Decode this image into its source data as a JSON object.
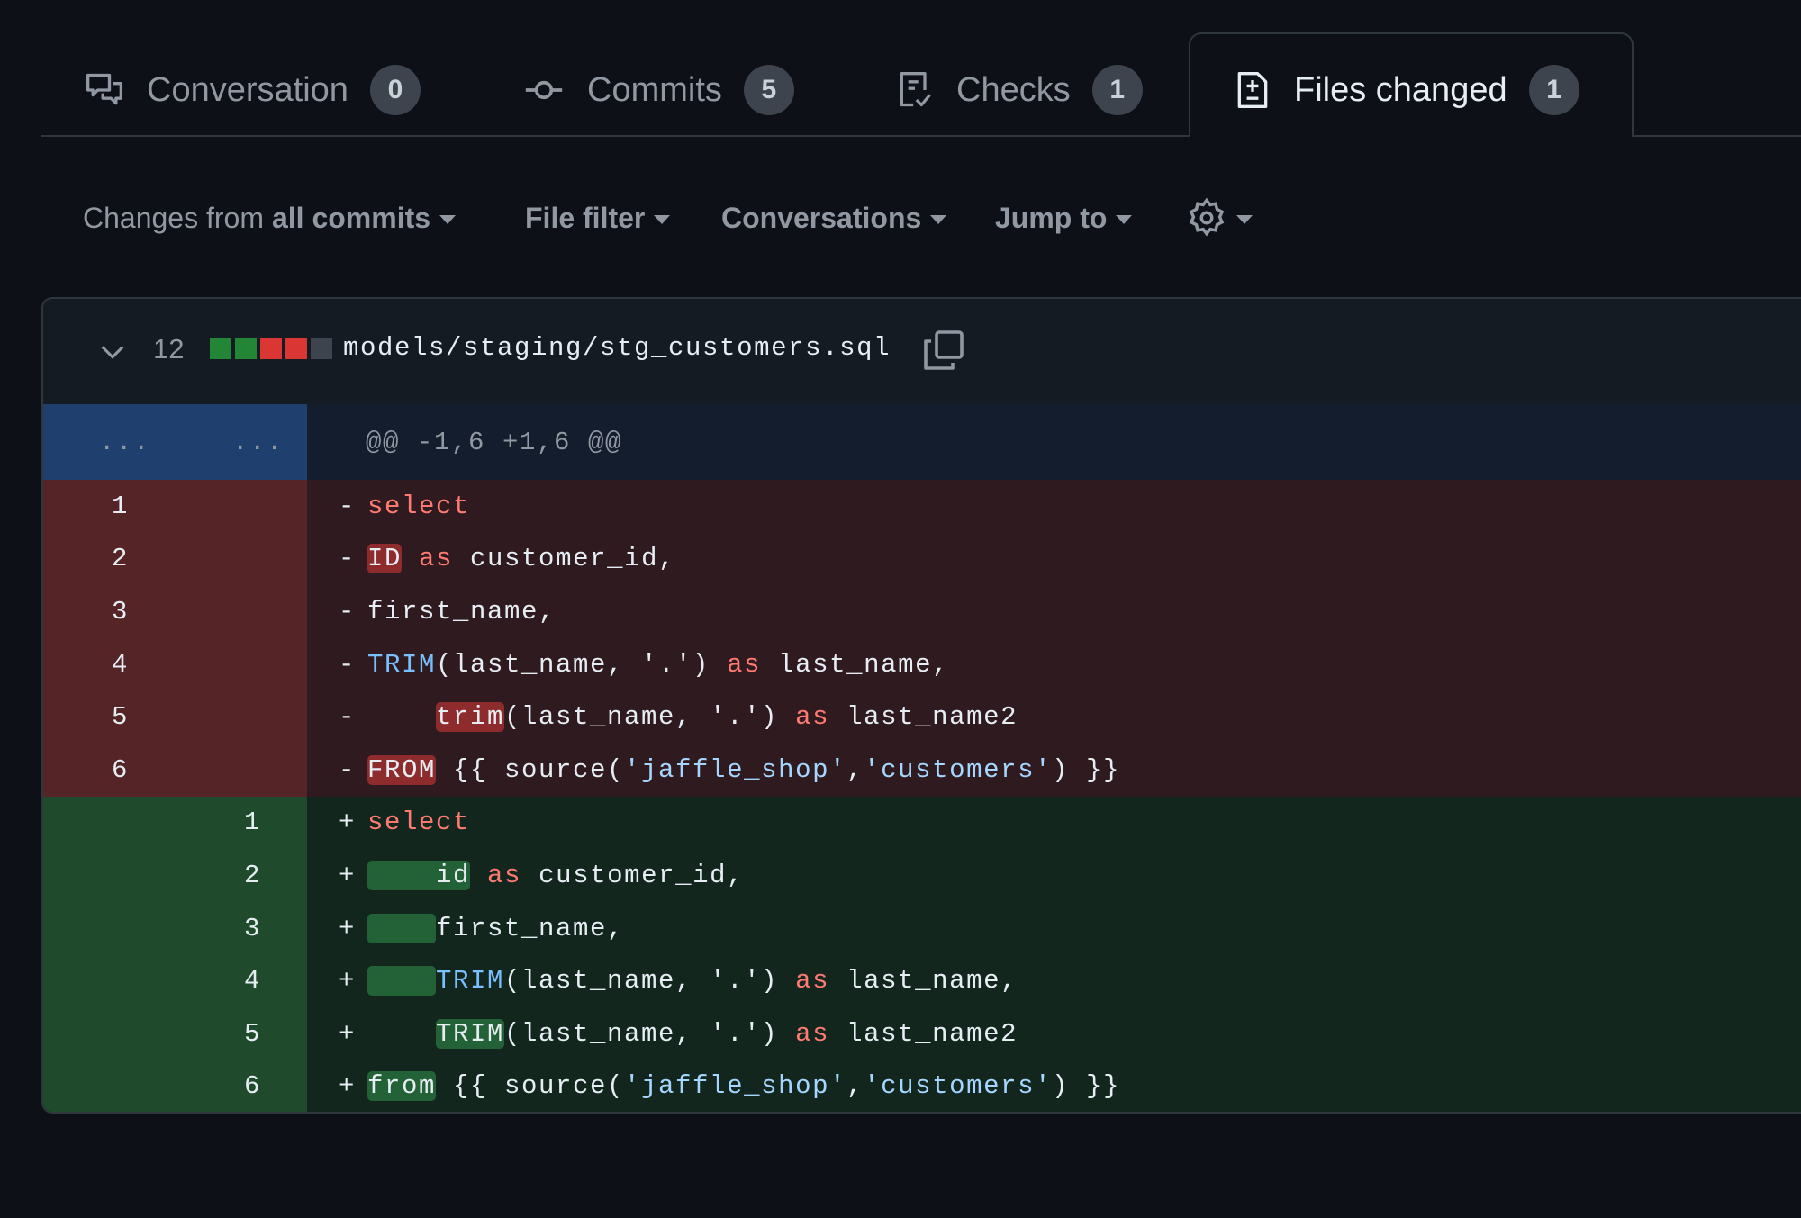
{
  "tabs": [
    {
      "label": "Conversation",
      "count": "0",
      "icon": "comment-discussion-icon"
    },
    {
      "label": "Commits",
      "count": "5",
      "icon": "git-commit-icon"
    },
    {
      "label": "Checks",
      "count": "1",
      "icon": "checklist-icon"
    },
    {
      "label": "Files changed",
      "count": "1",
      "icon": "file-diff-icon",
      "active": true
    }
  ],
  "toolbar": {
    "changes_prefix": "Changes from",
    "changes_value": "all commits",
    "file_filter": "File filter",
    "conversations": "Conversations",
    "jump_to": "Jump to",
    "settings_icon": "gear-icon"
  },
  "file": {
    "changes_count": "12",
    "diffstat": [
      "added",
      "added",
      "deleted",
      "deleted",
      "neutral"
    ],
    "path": "models/staging/stg_customers.sql",
    "hunk": {
      "old_expander": "...",
      "new_expander": "...",
      "header": "@@ -1,6 +1,6 @@"
    },
    "lines": [
      {
        "type": "del",
        "old": "1",
        "new": "",
        "sign": "-",
        "tokens": [
          {
            "t": "select",
            "c": "kw"
          }
        ]
      },
      {
        "type": "del",
        "old": "2",
        "new": "",
        "sign": "-",
        "tokens": [
          {
            "t": "ID",
            "c": "tx",
            "hl": true
          },
          {
            "t": " ",
            "c": "tx"
          },
          {
            "t": "as",
            "c": "kw"
          },
          {
            "t": " customer_id,",
            "c": "tx"
          }
        ]
      },
      {
        "type": "del",
        "old": "3",
        "new": "",
        "sign": "-",
        "tokens": [
          {
            "t": "first_name,",
            "c": "tx"
          }
        ]
      },
      {
        "type": "del",
        "old": "4",
        "new": "",
        "sign": "-",
        "tokens": [
          {
            "t": "TRIM",
            "c": "fn"
          },
          {
            "t": "(last_name, '.') ",
            "c": "tx"
          },
          {
            "t": "as",
            "c": "kw"
          },
          {
            "t": " last_name,",
            "c": "tx"
          }
        ]
      },
      {
        "type": "del",
        "old": "5",
        "new": "",
        "sign": "-",
        "tokens": [
          {
            "t": "    ",
            "c": "tx"
          },
          {
            "t": "trim",
            "c": "tx",
            "hl": true
          },
          {
            "t": "(last_name, '.') ",
            "c": "tx"
          },
          {
            "t": "as",
            "c": "kw"
          },
          {
            "t": " last_name2",
            "c": "tx"
          }
        ]
      },
      {
        "type": "del",
        "old": "6",
        "new": "",
        "sign": "-",
        "tokens": [
          {
            "t": "FROM",
            "c": "tx",
            "hl": true
          },
          {
            "t": " {{ source(",
            "c": "tx"
          },
          {
            "t": "'jaffle_shop'",
            "c": "st"
          },
          {
            "t": ",",
            "c": "tx"
          },
          {
            "t": "'customers'",
            "c": "st"
          },
          {
            "t": ") }}",
            "c": "tx"
          }
        ]
      },
      {
        "type": "add",
        "old": "",
        "new": "1",
        "sign": "+",
        "tokens": [
          {
            "t": "select",
            "c": "kw"
          }
        ]
      },
      {
        "type": "add",
        "old": "",
        "new": "2",
        "sign": "+",
        "tokens": [
          {
            "t": "    id",
            "c": "tx",
            "hl": true
          },
          {
            "t": " ",
            "c": "tx"
          },
          {
            "t": "as",
            "c": "kw"
          },
          {
            "t": " customer_id,",
            "c": "tx"
          }
        ]
      },
      {
        "type": "add",
        "old": "",
        "new": "3",
        "sign": "+",
        "tokens": [
          {
            "t": "    ",
            "c": "tx",
            "hl": true
          },
          {
            "t": "first_name,",
            "c": "tx"
          }
        ]
      },
      {
        "type": "add",
        "old": "",
        "new": "4",
        "sign": "+",
        "tokens": [
          {
            "t": "    ",
            "c": "tx",
            "hl": true
          },
          {
            "t": "TRIM",
            "c": "fn"
          },
          {
            "t": "(last_name, '.') ",
            "c": "tx"
          },
          {
            "t": "as",
            "c": "kw"
          },
          {
            "t": " last_name,",
            "c": "tx"
          }
        ]
      },
      {
        "type": "add",
        "old": "",
        "new": "5",
        "sign": "+",
        "tokens": [
          {
            "t": "    ",
            "c": "tx"
          },
          {
            "t": "TRIM",
            "c": "tx",
            "hl": true
          },
          {
            "t": "(last_name, '.') ",
            "c": "tx"
          },
          {
            "t": "as",
            "c": "kw"
          },
          {
            "t": " last_name2",
            "c": "tx"
          }
        ]
      },
      {
        "type": "add",
        "old": "",
        "new": "6",
        "sign": "+",
        "tokens": [
          {
            "t": "from",
            "c": "tx",
            "hl": true
          },
          {
            "t": " {{ source(",
            "c": "tx"
          },
          {
            "t": "'jaffle_shop'",
            "c": "st"
          },
          {
            "t": ",",
            "c": "tx"
          },
          {
            "t": "'customers'",
            "c": "st"
          },
          {
            "t": ") }}",
            "c": "tx"
          }
        ]
      }
    ]
  },
  "colors": {
    "background": "#0d1117",
    "del_gutter": "#542426",
    "del_code": "#2f1a1f",
    "add_gutter": "#1f4a2c",
    "add_code": "#12261e",
    "hunk_gutter": "#1f3f6e",
    "hunk_code": "#131d2e",
    "diffstat_added": "#238636",
    "diffstat_deleted": "#da3633",
    "diffstat_neutral": "#3d444d"
  }
}
